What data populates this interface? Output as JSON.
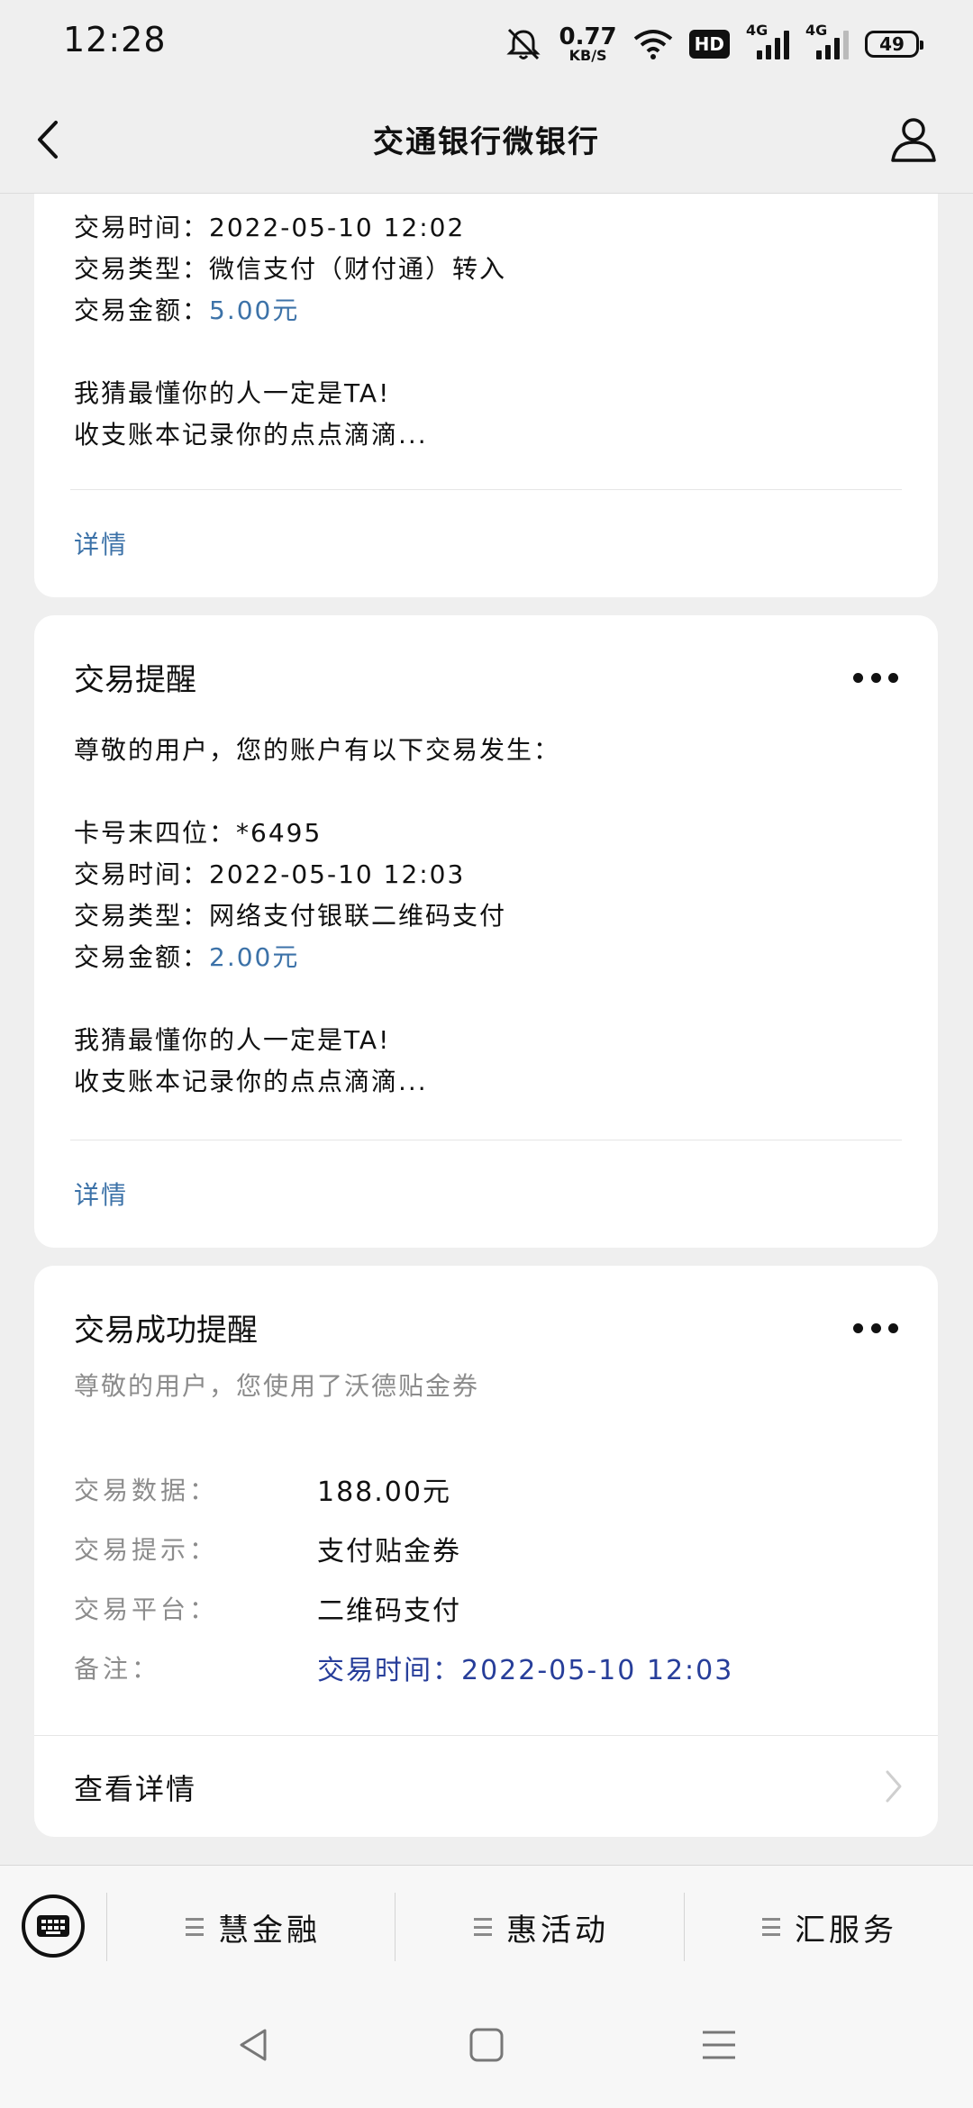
{
  "status_bar": {
    "time": "12:28",
    "net_speed": "0.77",
    "net_unit": "KB/S",
    "hd_label": "HD",
    "signal_label": "4G",
    "battery": "49"
  },
  "nav": {
    "title": "交通银行微银行"
  },
  "card1": {
    "time_line": "交易时间：2022-05-10 12:02",
    "type_line": "交易类型：微信支付（财付通）转入",
    "amount_label": "交易金额：",
    "amount_value": "5.00元",
    "promo_line1": "我猜最懂你的人一定是TA!",
    "promo_line2": "收支账本记录你的点点滴滴...",
    "detail_link": "详情"
  },
  "card2": {
    "title": "交易提醒",
    "greeting": "尊敬的用户，您的账户有以下交易发生：",
    "card_line": "卡号末四位：*6495",
    "time_line": "交易时间：2022-05-10 12:03",
    "type_line": "交易类型：网络支付银联二维码支付",
    "amount_label": "交易金额：",
    "amount_value": "2.00元",
    "promo_line1": "我猜最懂你的人一定是TA!",
    "promo_line2": "收支账本记录你的点点滴滴...",
    "detail_link": "详情"
  },
  "card3": {
    "title": "交易成功提醒",
    "subtitle": "尊敬的用户，您使用了沃德贴金券",
    "rows": [
      {
        "key": "交易数据：",
        "value": "188.00元"
      },
      {
        "key": "交易提示：",
        "value": "支付贴金券"
      },
      {
        "key": "交易平台：",
        "value": "二维码支付"
      },
      {
        "key": "备注：",
        "value": "交易时间：2022-05-10 12:03"
      }
    ],
    "footer_link": "查看详情"
  },
  "bottom_menu": {
    "items": [
      "慧金融",
      "惠活动",
      "汇服务"
    ]
  },
  "colors": {
    "link_blue": "#3c72a8",
    "note_blue": "#273e9a",
    "background": "#efefef",
    "card": "#ffffff"
  }
}
